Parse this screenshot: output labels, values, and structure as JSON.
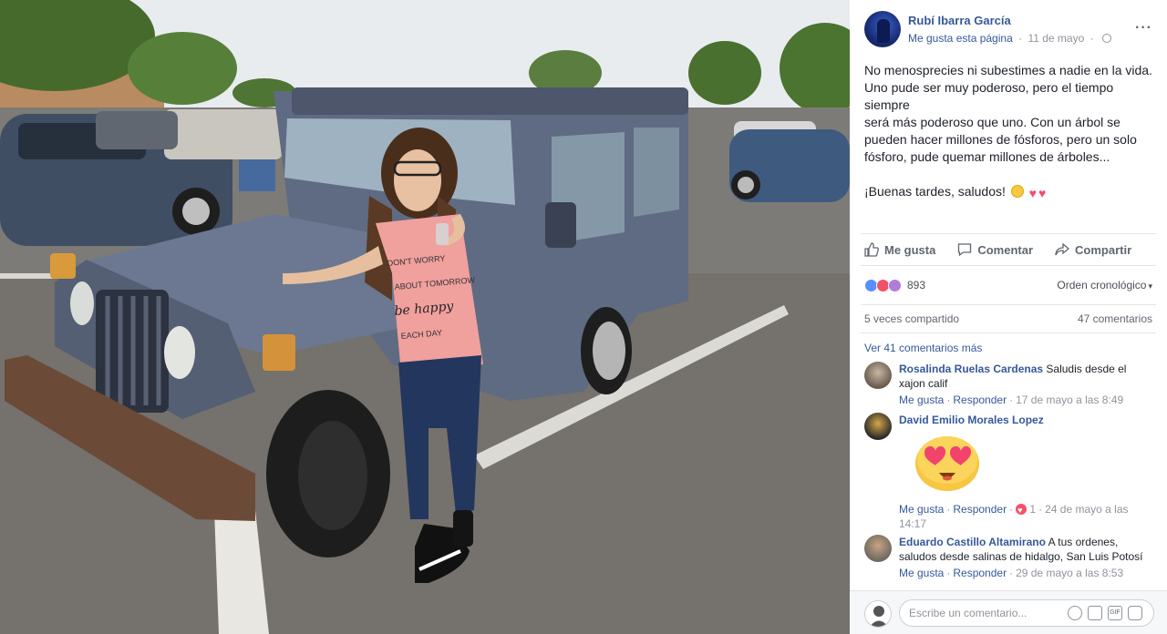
{
  "post": {
    "author": "Rubí Ibarra García",
    "like_page": "Me gusta esta página",
    "date": "11 de mayo",
    "more": "···",
    "text_lines": [
      "No menosprecies ni subestimes a nadie en la vida.",
      "Uno pude ser muy poderoso, pero el tiempo siempre",
      "será más poderoso que uno. Con un árbol se",
      "pueden hacer millones de fósforos, pero un solo",
      "fósforo, pude quemar millones de árboles..."
    ],
    "greeting": "¡Buenas tardes, saludos!",
    "photo_shirt_text": "DON'T WORRY ABOUT TOMORROW be happy EACH DAY"
  },
  "actions": {
    "like": "Me gusta",
    "comment": "Comentar",
    "share": "Compartir"
  },
  "stats": {
    "reactions_count": "893",
    "order": "Orden cronológico",
    "shares": "5 veces compartido",
    "comments": "47 comentarios",
    "view_more": "Ver 41 comentarios más"
  },
  "comments": [
    {
      "name": "Rosalinda Ruelas Cardenas",
      "text": "Saludis desde el xajon calif",
      "like": "Me gusta",
      "reply": "Responder",
      "time": "17 de mayo a las 8:49"
    },
    {
      "name": "David Emilio Morales Lopez",
      "text": "",
      "like": "Me gusta",
      "reply": "Responder",
      "reaction_count": "1",
      "time": "24 de mayo a las 14:17"
    },
    {
      "name": "Eduardo Castillo Altamirano",
      "text": "A tus ordenes, saludos desde salinas de hidalgo, San Luis Potosí",
      "like": "Me gusta",
      "reply": "Responder",
      "time": "29 de mayo a las 8:53"
    }
  ],
  "composer": {
    "placeholder": "Escribe un comentario..."
  },
  "colors": {
    "link": "#365899",
    "meta": "#90949c",
    "text": "#1d2129",
    "jeep": "#5f6b82"
  }
}
